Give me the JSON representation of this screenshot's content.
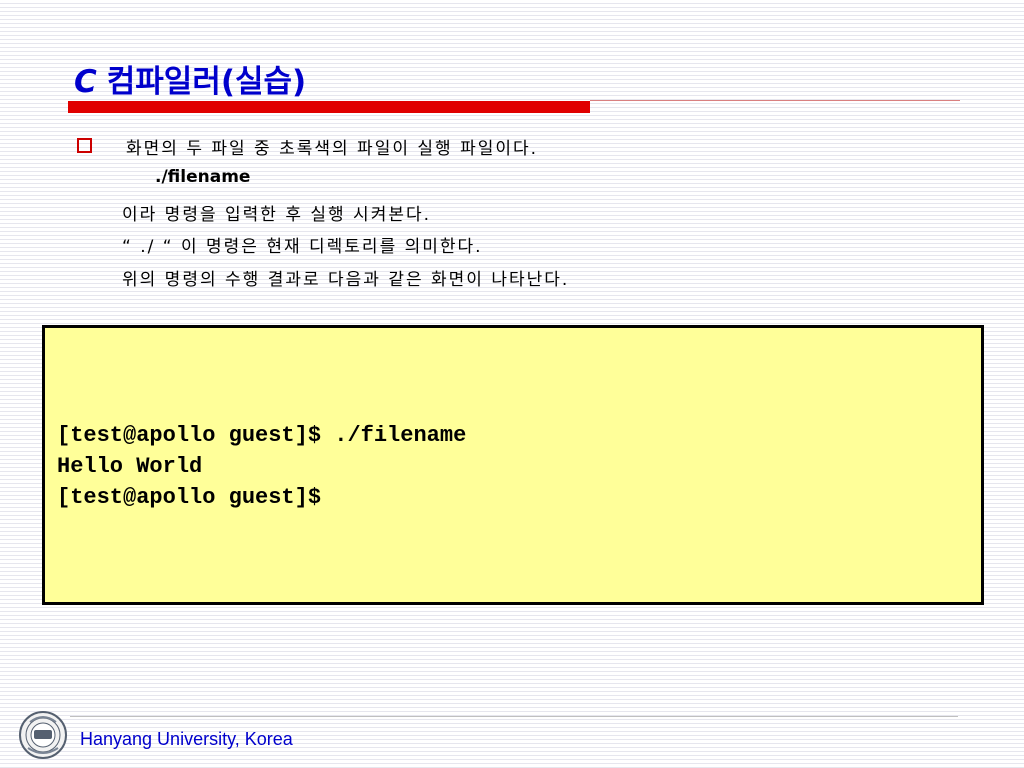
{
  "slide": {
    "title_c": "C",
    "title_rest": "컴파일러(실습)",
    "bullet_line": "화면의 두 파일 중 초록색의 파일이 실행 파일이다.",
    "command_line": "./filename",
    "line3": "이라 명령을 입력한 후 실행 시켜본다.",
    "line4": "“ ./ “ 이 명령은 현재 디렉토리를 의미한다.",
    "line5": "위의 명령의 수행 결과로 다음과 같은 화면이 나타난다."
  },
  "terminal": {
    "lines": [
      "[test@apollo guest]$ ./filename",
      "Hello World",
      "[test@apollo guest]$"
    ]
  },
  "footer": {
    "institution": "Hanyang University, Korea"
  },
  "colors": {
    "title": "#0000cc",
    "accent_bar": "#e00000",
    "terminal_bg": "#ffff99",
    "footer_text": "#0000cc"
  },
  "icons": {
    "bullet": "hollow-square-bullet-icon",
    "logo": "university-seal-icon"
  }
}
